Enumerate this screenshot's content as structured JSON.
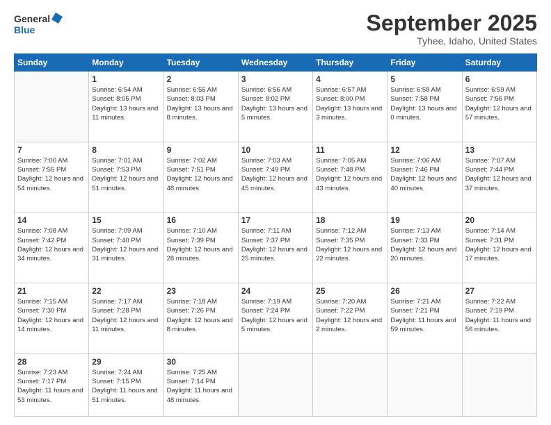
{
  "logo": {
    "line1": "General",
    "line2": "Blue"
  },
  "title": "September 2025",
  "location": "Tyhee, Idaho, United States",
  "days_of_week": [
    "Sunday",
    "Monday",
    "Tuesday",
    "Wednesday",
    "Thursday",
    "Friday",
    "Saturday"
  ],
  "weeks": [
    [
      {
        "day": "",
        "info": ""
      },
      {
        "day": "1",
        "info": "Sunrise: 6:54 AM\nSunset: 8:05 PM\nDaylight: 13 hours\nand 11 minutes."
      },
      {
        "day": "2",
        "info": "Sunrise: 6:55 AM\nSunset: 8:03 PM\nDaylight: 13 hours\nand 8 minutes."
      },
      {
        "day": "3",
        "info": "Sunrise: 6:56 AM\nSunset: 8:02 PM\nDaylight: 13 hours\nand 5 minutes."
      },
      {
        "day": "4",
        "info": "Sunrise: 6:57 AM\nSunset: 8:00 PM\nDaylight: 13 hours\nand 3 minutes."
      },
      {
        "day": "5",
        "info": "Sunrise: 6:58 AM\nSunset: 7:58 PM\nDaylight: 13 hours\nand 0 minutes."
      },
      {
        "day": "6",
        "info": "Sunrise: 6:59 AM\nSunset: 7:56 PM\nDaylight: 12 hours\nand 57 minutes."
      }
    ],
    [
      {
        "day": "7",
        "info": "Sunrise: 7:00 AM\nSunset: 7:55 PM\nDaylight: 12 hours\nand 54 minutes."
      },
      {
        "day": "8",
        "info": "Sunrise: 7:01 AM\nSunset: 7:53 PM\nDaylight: 12 hours\nand 51 minutes."
      },
      {
        "day": "9",
        "info": "Sunrise: 7:02 AM\nSunset: 7:51 PM\nDaylight: 12 hours\nand 48 minutes."
      },
      {
        "day": "10",
        "info": "Sunrise: 7:03 AM\nSunset: 7:49 PM\nDaylight: 12 hours\nand 45 minutes."
      },
      {
        "day": "11",
        "info": "Sunrise: 7:05 AM\nSunset: 7:48 PM\nDaylight: 12 hours\nand 43 minutes."
      },
      {
        "day": "12",
        "info": "Sunrise: 7:06 AM\nSunset: 7:46 PM\nDaylight: 12 hours\nand 40 minutes."
      },
      {
        "day": "13",
        "info": "Sunrise: 7:07 AM\nSunset: 7:44 PM\nDaylight: 12 hours\nand 37 minutes."
      }
    ],
    [
      {
        "day": "14",
        "info": "Sunrise: 7:08 AM\nSunset: 7:42 PM\nDaylight: 12 hours\nand 34 minutes."
      },
      {
        "day": "15",
        "info": "Sunrise: 7:09 AM\nSunset: 7:40 PM\nDaylight: 12 hours\nand 31 minutes."
      },
      {
        "day": "16",
        "info": "Sunrise: 7:10 AM\nSunset: 7:39 PM\nDaylight: 12 hours\nand 28 minutes."
      },
      {
        "day": "17",
        "info": "Sunrise: 7:11 AM\nSunset: 7:37 PM\nDaylight: 12 hours\nand 25 minutes."
      },
      {
        "day": "18",
        "info": "Sunrise: 7:12 AM\nSunset: 7:35 PM\nDaylight: 12 hours\nand 22 minutes."
      },
      {
        "day": "19",
        "info": "Sunrise: 7:13 AM\nSunset: 7:33 PM\nDaylight: 12 hours\nand 20 minutes."
      },
      {
        "day": "20",
        "info": "Sunrise: 7:14 AM\nSunset: 7:31 PM\nDaylight: 12 hours\nand 17 minutes."
      }
    ],
    [
      {
        "day": "21",
        "info": "Sunrise: 7:15 AM\nSunset: 7:30 PM\nDaylight: 12 hours\nand 14 minutes."
      },
      {
        "day": "22",
        "info": "Sunrise: 7:17 AM\nSunset: 7:28 PM\nDaylight: 12 hours\nand 11 minutes."
      },
      {
        "day": "23",
        "info": "Sunrise: 7:18 AM\nSunset: 7:26 PM\nDaylight: 12 hours\nand 8 minutes."
      },
      {
        "day": "24",
        "info": "Sunrise: 7:19 AM\nSunset: 7:24 PM\nDaylight: 12 hours\nand 5 minutes."
      },
      {
        "day": "25",
        "info": "Sunrise: 7:20 AM\nSunset: 7:22 PM\nDaylight: 12 hours\nand 2 minutes."
      },
      {
        "day": "26",
        "info": "Sunrise: 7:21 AM\nSunset: 7:21 PM\nDaylight: 11 hours\nand 59 minutes."
      },
      {
        "day": "27",
        "info": "Sunrise: 7:22 AM\nSunset: 7:19 PM\nDaylight: 11 hours\nand 56 minutes."
      }
    ],
    [
      {
        "day": "28",
        "info": "Sunrise: 7:23 AM\nSunset: 7:17 PM\nDaylight: 11 hours\nand 53 minutes."
      },
      {
        "day": "29",
        "info": "Sunrise: 7:24 AM\nSunset: 7:15 PM\nDaylight: 11 hours\nand 51 minutes."
      },
      {
        "day": "30",
        "info": "Sunrise: 7:25 AM\nSunset: 7:14 PM\nDaylight: 11 hours\nand 48 minutes."
      },
      {
        "day": "",
        "info": ""
      },
      {
        "day": "",
        "info": ""
      },
      {
        "day": "",
        "info": ""
      },
      {
        "day": "",
        "info": ""
      }
    ]
  ]
}
